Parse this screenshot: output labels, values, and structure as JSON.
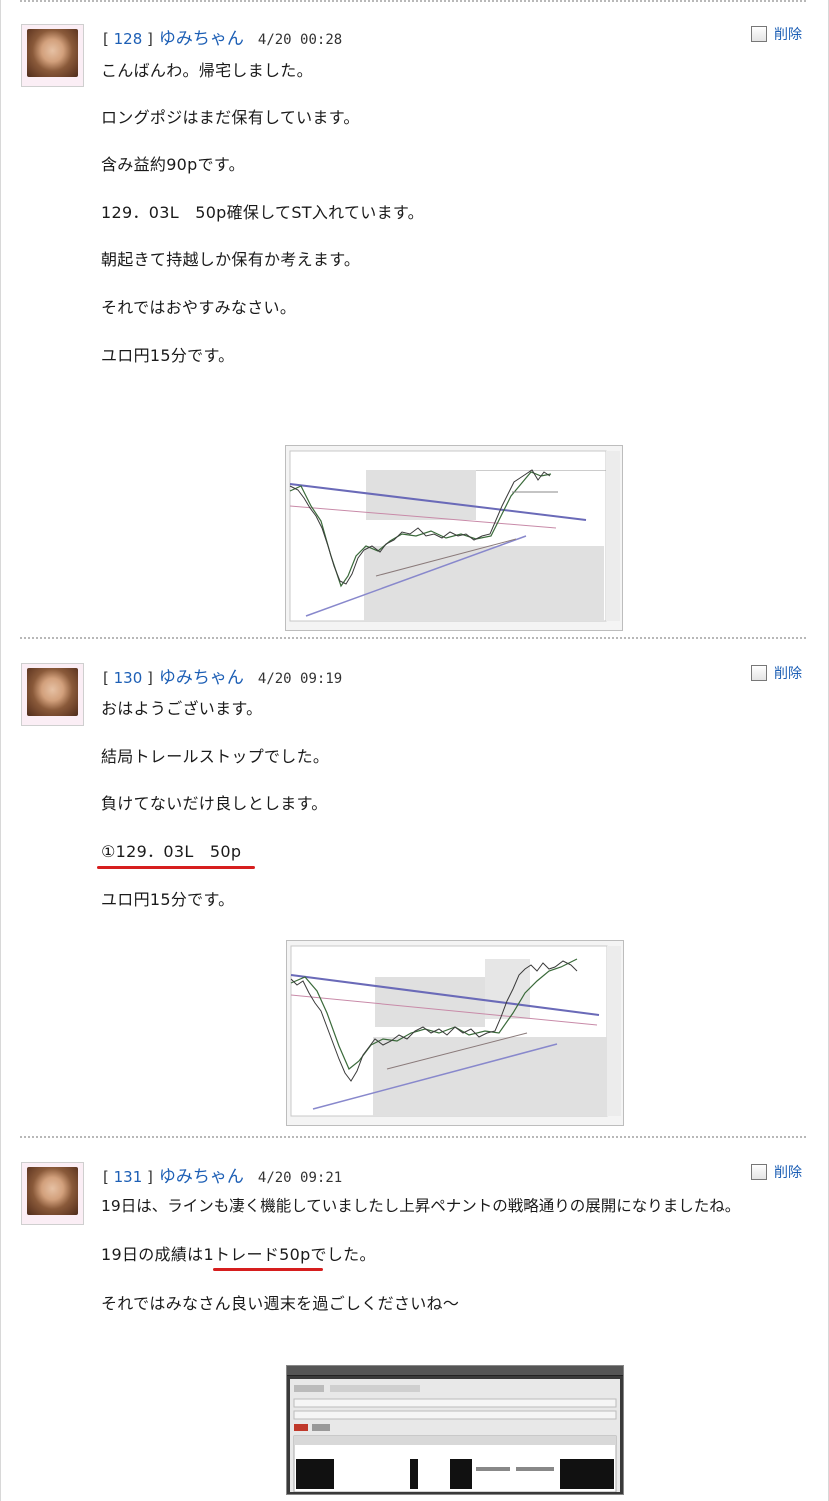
{
  "posts": [
    {
      "number": "128",
      "author": "ゆみちゃん",
      "date": "4/20 00:28",
      "delete_label": "削除",
      "lines": [
        "こんばんわ。帰宅しました。",
        "ロングポジはまだ保有しています。",
        "含み益約90pです。",
        "129．03L　50p確保してST入れています。",
        "朝起きて持越しか保有か考えます。",
        "それではおやすみなさい。",
        "ユロ円15分です。"
      ]
    },
    {
      "number": "130",
      "author": "ゆみちゃん",
      "date": "4/20 09:19",
      "delete_label": "削除",
      "lines": [
        "おはようございます。",
        "結局トレールストップでした。",
        "負けてないだけ良しとします。",
        "①129．03L　50p",
        "ユロ円15分です。"
      ]
    },
    {
      "number": "131",
      "author": "ゆみちゃん",
      "date": "4/20 09:21",
      "delete_label": "削除",
      "lines": [
        "19日は、ラインも凄く機能していましたし上昇ペナントの戦略通りの展開になりましたね。",
        "19日の成績は1トレード50pでした。",
        "それではみなさん良い週末を過ごしくださいね～"
      ]
    }
  ],
  "icons": {
    "avatar": "avatar-photo",
    "checkbox": "delete-checkbox"
  },
  "colors": {
    "link": "#1d5fb5",
    "underline": "#d61e1e",
    "text": "#1a1a1a"
  }
}
